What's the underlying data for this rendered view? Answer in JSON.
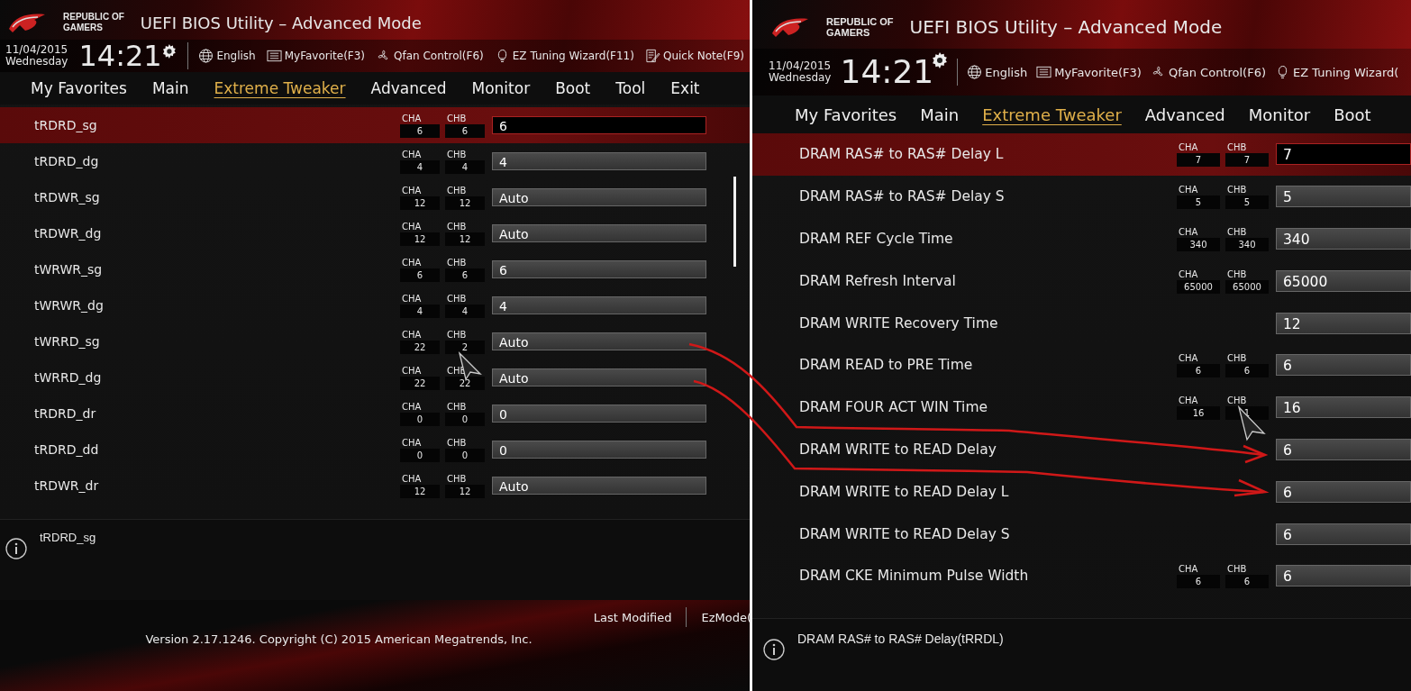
{
  "panels": [
    {
      "brand": [
        "REPUBLIC OF",
        "GAMERS"
      ],
      "title": "UEFI BIOS Utility – Advanced Mode",
      "date": "11/04/2015",
      "day": "Wednesday",
      "time": "14:21",
      "toolbar": [
        {
          "kind": "globe",
          "label": "English"
        },
        {
          "kind": "list",
          "label": "MyFavorite(F3)"
        },
        {
          "kind": "fan",
          "label": "Qfan Control(F6)"
        },
        {
          "kind": "bulb",
          "label": "EZ Tuning Wizard(F11)"
        },
        {
          "kind": "note",
          "label": "Quick Note(F9)"
        }
      ],
      "tabs": [
        {
          "label": "My Favorites",
          "selected": false
        },
        {
          "label": "Main",
          "selected": false
        },
        {
          "label": "Extreme Tweaker",
          "selected": true
        },
        {
          "label": "Advanced",
          "selected": false
        },
        {
          "label": "Monitor",
          "selected": false
        },
        {
          "label": "Boot",
          "selected": false
        },
        {
          "label": "Tool",
          "selected": false
        },
        {
          "label": "Exit",
          "selected": false
        }
      ],
      "rows": [
        {
          "label": "tRDRD_sg",
          "selected": true,
          "channels": [
            {
              "label": "CHA",
              "value": "6"
            },
            {
              "label": "CHB",
              "value": "6"
            }
          ],
          "value": "6"
        },
        {
          "label": "tRDRD_dg",
          "selected": false,
          "channels": [
            {
              "label": "CHA",
              "value": "4"
            },
            {
              "label": "CHB",
              "value": "4"
            }
          ],
          "value": "4"
        },
        {
          "label": "tRDWR_sg",
          "selected": false,
          "channels": [
            {
              "label": "CHA",
              "value": "12"
            },
            {
              "label": "CHB",
              "value": "12"
            }
          ],
          "value": "Auto"
        },
        {
          "label": "tRDWR_dg",
          "selected": false,
          "channels": [
            {
              "label": "CHA",
              "value": "12"
            },
            {
              "label": "CHB",
              "value": "12"
            }
          ],
          "value": "Auto"
        },
        {
          "label": "tWRWR_sg",
          "selected": false,
          "channels": [
            {
              "label": "CHA",
              "value": "6"
            },
            {
              "label": "CHB",
              "value": "6"
            }
          ],
          "value": "6"
        },
        {
          "label": "tWRWR_dg",
          "selected": false,
          "channels": [
            {
              "label": "CHA",
              "value": "4"
            },
            {
              "label": "CHB",
              "value": "4"
            }
          ],
          "value": "4"
        },
        {
          "label": "tWRRD_sg",
          "selected": false,
          "channels": [
            {
              "label": "CHA",
              "value": "22"
            },
            {
              "label": "CHB",
              "value": "2"
            }
          ],
          "value": "Auto"
        },
        {
          "label": "tWRRD_dg",
          "selected": false,
          "channels": [
            {
              "label": "CHA",
              "value": "22"
            },
            {
              "label": "CHB",
              "value": "22"
            }
          ],
          "value": "Auto"
        },
        {
          "label": "tRDRD_dr",
          "selected": false,
          "channels": [
            {
              "label": "CHA",
              "value": "0"
            },
            {
              "label": "CHB",
              "value": "0"
            }
          ],
          "value": "0"
        },
        {
          "label": "tRDRD_dd",
          "selected": false,
          "channels": [
            {
              "label": "CHA",
              "value": "0"
            },
            {
              "label": "CHB",
              "value": "0"
            }
          ],
          "value": "0"
        },
        {
          "label": "tRDWR_dr",
          "selected": false,
          "channels": [
            {
              "label": "CHA",
              "value": "12"
            },
            {
              "label": "CHB",
              "value": "12"
            }
          ],
          "value": "Auto"
        }
      ],
      "help": "tRDRD_sg",
      "footer": {
        "links": [
          "Last Modified",
          "EzMode("
        ],
        "version": "Version 2.17.1246. Copyright (C) 2015 American Megatrends, Inc."
      }
    },
    {
      "brand": [
        "REPUBLIC OF",
        "GAMERS"
      ],
      "title": "UEFI BIOS Utility – Advanced Mode",
      "date": "11/04/2015",
      "day": "Wednesday",
      "time": "14:21",
      "toolbar": [
        {
          "kind": "globe",
          "label": "English"
        },
        {
          "kind": "list",
          "label": "MyFavorite(F3)"
        },
        {
          "kind": "fan",
          "label": "Qfan Control(F6)"
        },
        {
          "kind": "bulb",
          "label": "EZ Tuning Wizard("
        }
      ],
      "tabs": [
        {
          "label": "My Favorites",
          "selected": false
        },
        {
          "label": "Main",
          "selected": false
        },
        {
          "label": "Extreme Tweaker",
          "selected": true
        },
        {
          "label": "Advanced",
          "selected": false
        },
        {
          "label": "Monitor",
          "selected": false
        },
        {
          "label": "Boot",
          "selected": false
        }
      ],
      "rows": [
        {
          "label": "DRAM RAS# to RAS# Delay L",
          "selected": true,
          "channels": [
            {
              "label": "CHA",
              "value": "7"
            },
            {
              "label": "CHB",
              "value": "7"
            }
          ],
          "value": "7"
        },
        {
          "label": "DRAM RAS# to RAS# Delay S",
          "selected": false,
          "channels": [
            {
              "label": "CHA",
              "value": "5"
            },
            {
              "label": "CHB",
              "value": "5"
            }
          ],
          "value": "5"
        },
        {
          "label": "DRAM REF Cycle Time",
          "selected": false,
          "channels": [
            {
              "label": "CHA",
              "value": "340"
            },
            {
              "label": "CHB",
              "value": "340"
            }
          ],
          "value": "340"
        },
        {
          "label": "DRAM Refresh Interval",
          "selected": false,
          "channels": [
            {
              "label": "CHA",
              "value": "65000"
            },
            {
              "label": "CHB",
              "value": "65000"
            }
          ],
          "value": "65000"
        },
        {
          "label": "DRAM WRITE Recovery Time",
          "selected": false,
          "value": "12"
        },
        {
          "label": "DRAM READ to PRE Time",
          "selected": false,
          "channels": [
            {
              "label": "CHA",
              "value": "6"
            },
            {
              "label": "CHB",
              "value": "6"
            }
          ],
          "value": "6"
        },
        {
          "label": "DRAM FOUR ACT WIN Time",
          "selected": false,
          "channels": [
            {
              "label": "CHA",
              "value": "16"
            },
            {
              "label": "CHB",
              "value": "1"
            }
          ],
          "value": "16"
        },
        {
          "label": "DRAM WRITE to READ Delay",
          "selected": false,
          "value": "6"
        },
        {
          "label": "DRAM WRITE to READ Delay L",
          "selected": false,
          "value": "6"
        },
        {
          "label": "DRAM WRITE to READ Delay S",
          "selected": false,
          "value": "6"
        },
        {
          "label": "DRAM CKE Minimum Pulse Width",
          "selected": false,
          "channels": [
            {
              "label": "CHA",
              "value": "6"
            },
            {
              "label": "CHB",
              "value": "6"
            }
          ],
          "value": "6"
        }
      ],
      "help": "DRAM RAS# to RAS# Delay(tRRDL)"
    }
  ]
}
